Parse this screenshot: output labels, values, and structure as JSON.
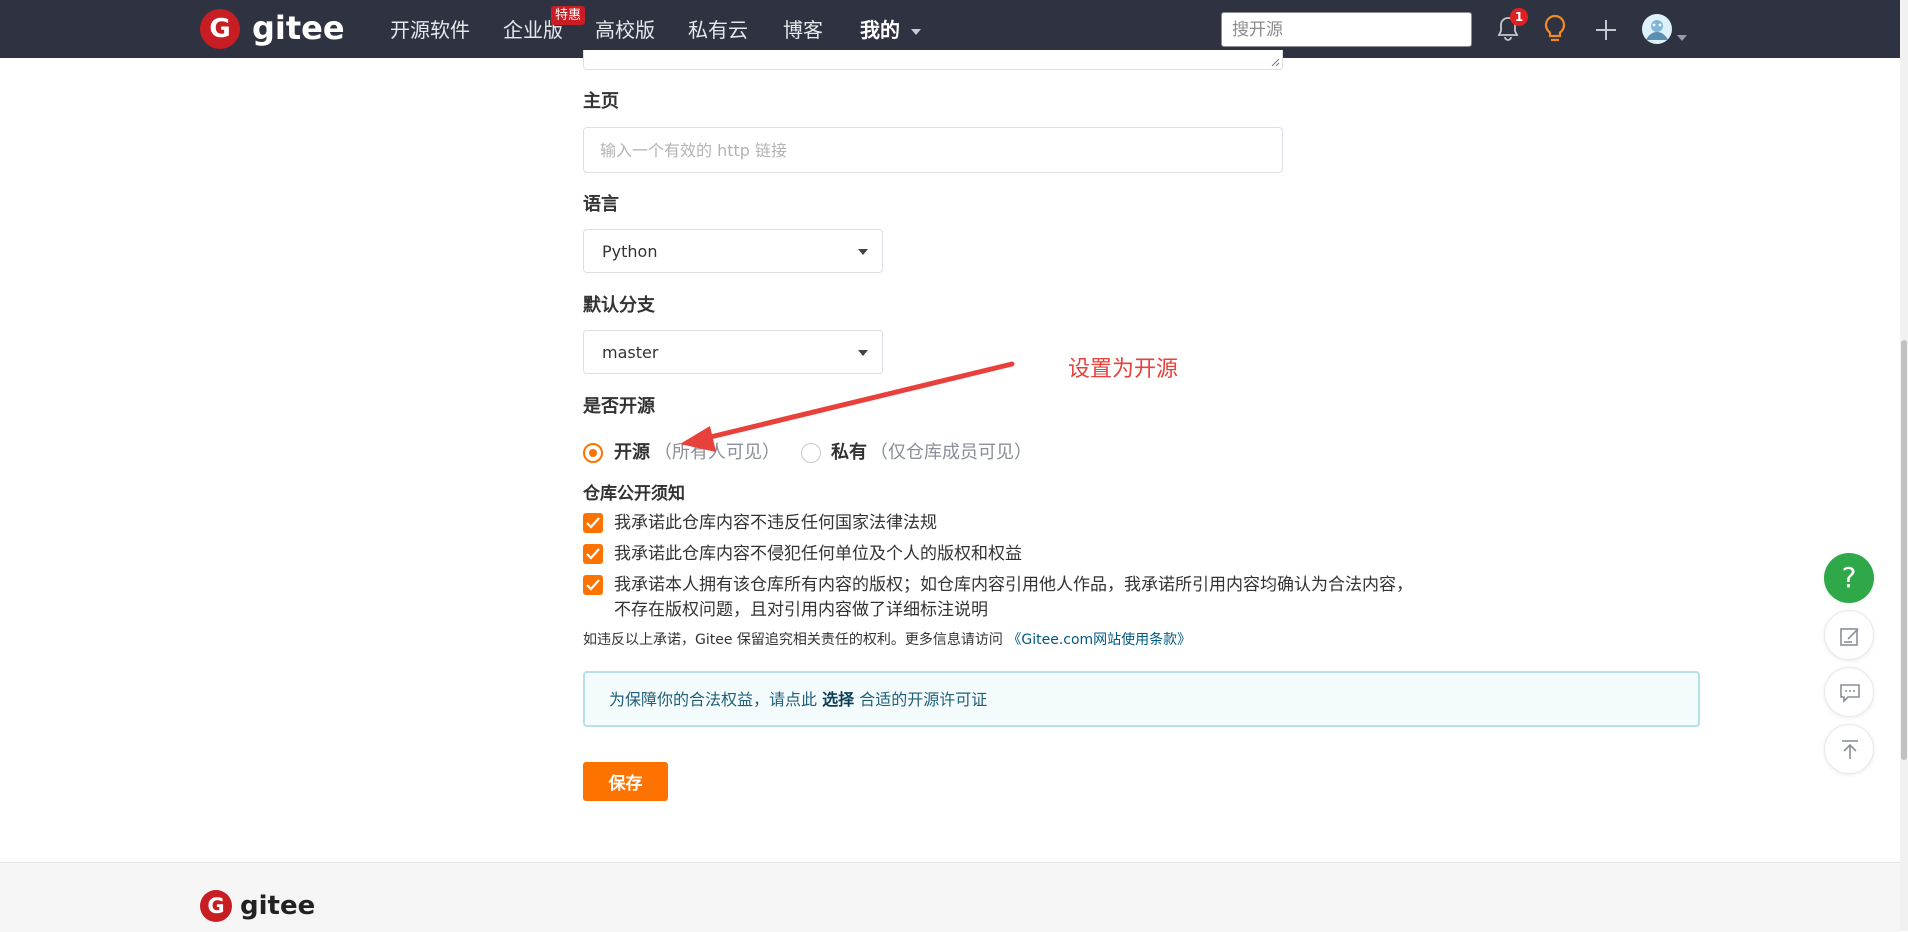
{
  "nav": {
    "logo_glyph": "G",
    "logo_text": "gitee",
    "items": [
      "开源软件",
      "企业版",
      "高校版",
      "私有云",
      "博客"
    ],
    "mine": "我的",
    "enterprise_badge": "特惠",
    "search_placeholder": "搜开源",
    "notification_count": "1"
  },
  "form": {
    "homepage_label": "主页",
    "homepage_placeholder": "输入一个有效的 http 链接",
    "language_label": "语言",
    "language_value": "Python",
    "branch_label": "默认分支",
    "branch_value": "master",
    "visibility_label": "是否开源",
    "public_label": "开源",
    "public_hint": "（所有人可见）",
    "private_label": "私有",
    "private_hint": "（仅仓库成员可见）",
    "selected_visibility": "public",
    "notice_title": "仓库公开须知",
    "pledges": [
      "我承诺此仓库内容不违反任何国家法律法规",
      "我承诺此仓库内容不侵犯任何单位及个人的版权和权益",
      "我承诺本人拥有该仓库所有内容的版权；如仓库内容引用他人作品，我承诺所引用内容均确认为合法内容，",
      "不存在版权问题，且对引用内容做了详细标注说明"
    ],
    "note_text": "如违反以上承诺，Gitee 保留追究相关责任的权利。更多信息请访问",
    "note_link": "《Gitee.com网站使用条款》",
    "license_prefix": "为保障你的合法权益，请点此",
    "license_link": "选择",
    "license_suffix": "合适的开源许可证",
    "save_label": "保存"
  },
  "annotation": {
    "text": "设置为开源",
    "color": "#e8413c"
  },
  "floating": {
    "help_glyph": "?"
  },
  "colors": {
    "nav_bg": "#2f3341",
    "brand_red": "#c71d23",
    "accent_orange": "#fe7300",
    "help_green": "#2ea848",
    "info_border": "#b6dfe8"
  },
  "footer": {
    "logo_text": "gitee"
  }
}
